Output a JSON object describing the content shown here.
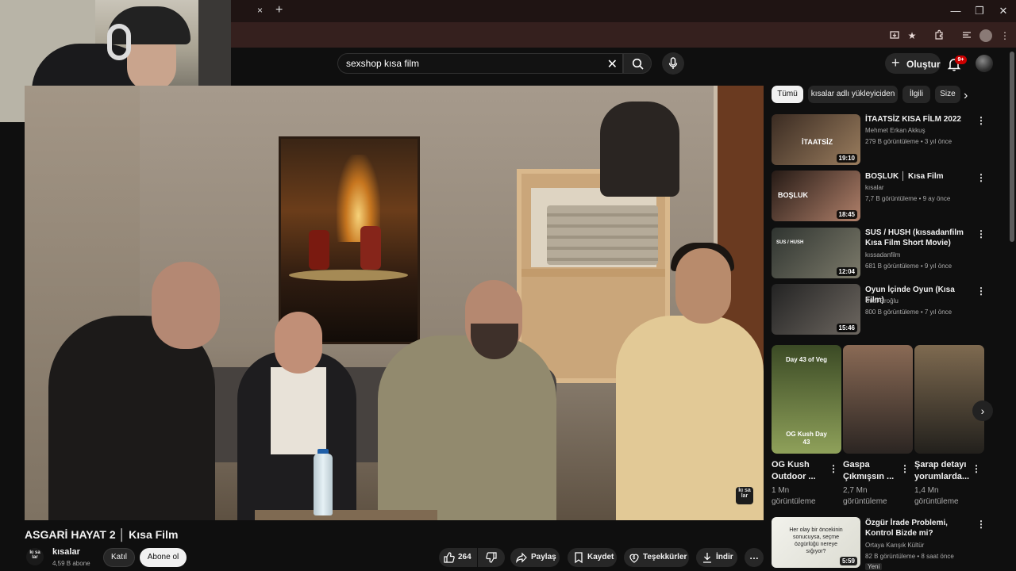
{
  "browser": {
    "tab_close": "×",
    "tab_new": "+",
    "minimize": "—",
    "restore": "❐",
    "close": "✕"
  },
  "header": {
    "search_value": "sexshop kısa film",
    "create_label": "Oluştur",
    "notification_count": "9+"
  },
  "video": {
    "title": "ASGARİ HAYAT 2 │ Kısa Film",
    "watermark": "kı sa lar",
    "channel": {
      "avatar_text": "kı sa lar",
      "name": "kısalar",
      "subscribers": "4,59 B abone",
      "join_label": "Katıl",
      "subscribe_label": "Abone ol"
    },
    "actions": {
      "likes": "264",
      "share": "Paylaş",
      "save": "Kaydet",
      "thanks": "Teşekkürler",
      "download": "İndir",
      "more": "…"
    }
  },
  "chips": [
    "Tümü",
    "kısalar adlı yükleyiciden",
    "İlgili",
    "Size"
  ],
  "recommendations": [
    {
      "title": "İTAATSİZ KISA FİLM 2022",
      "channel": "Mehmet Erkan Akkuş",
      "stats": "279 B görüntüleme • 3 yıl önce",
      "duration": "19:10",
      "thumb_text": "İTAATSİZ",
      "colors": [
        "#3a2b22",
        "#9a7d5e"
      ]
    },
    {
      "title": "BOŞLUK │ Kısa Film",
      "channel": "kısalar",
      "stats": "7,7 B görüntüleme • 9 ay önce",
      "duration": "18:45",
      "thumb_text": "BOŞLUK",
      "colors": [
        "#251a15",
        "#b0806a"
      ]
    },
    {
      "title": "SUS / HUSH (kıssadanfilm Kısa Film Short Movie)",
      "channel": "kıssadanfilm",
      "stats": "681 B görüntüleme • 9 yıl önce",
      "duration": "12:04",
      "thumb_text": "SUS / HUSH",
      "colors": [
        "#2f3430",
        "#7c7a6a"
      ]
    },
    {
      "title": "Oyun İçinde Oyun (Kısa Film)",
      "channel": "Suat Eroğlu",
      "stats": "800 B görüntüleme • 7 yıl önce",
      "duration": "15:46",
      "thumb_text": "",
      "colors": [
        "#232323",
        "#6d6760"
      ]
    },
    {
      "title": "Özgür İrade Problemi, Kontrol Bizde mi?",
      "channel": "Ortaya Karışık Kültür",
      "stats": "82 B görüntüleme • 8 saat önce",
      "badge": "Yeni",
      "duration": "5:59",
      "thumb_text": "Her olay bir öncekinin sonucuysa, seçme özgürlüğü nereye sığıyor?",
      "colors": [
        "#f2f2ec",
        "#dcdcd2"
      ]
    }
  ],
  "shorts": [
    {
      "title": "OG Kush Outdoor ...",
      "views": "1 Mn görüntüleme",
      "overlay_top": "Day 43 of Veg",
      "overlay_bottom": "OG Kush Day 43",
      "colors": [
        "#8fa15a",
        "#3b4a25"
      ]
    },
    {
      "title": "Gaspa Çıkmışsın ...",
      "views": "2,7 Mn görüntüleme",
      "overlay_top": "",
      "overlay_bottom": "",
      "colors": [
        "#2b2522",
        "#8a6a55"
      ]
    },
    {
      "title": "Şarap detayı yorumlarda...",
      "views": "1,4 Mn görüntüleme",
      "overlay_top": "",
      "overlay_bottom": "",
      "colors": [
        "#22201c",
        "#7e6a50"
      ]
    }
  ]
}
